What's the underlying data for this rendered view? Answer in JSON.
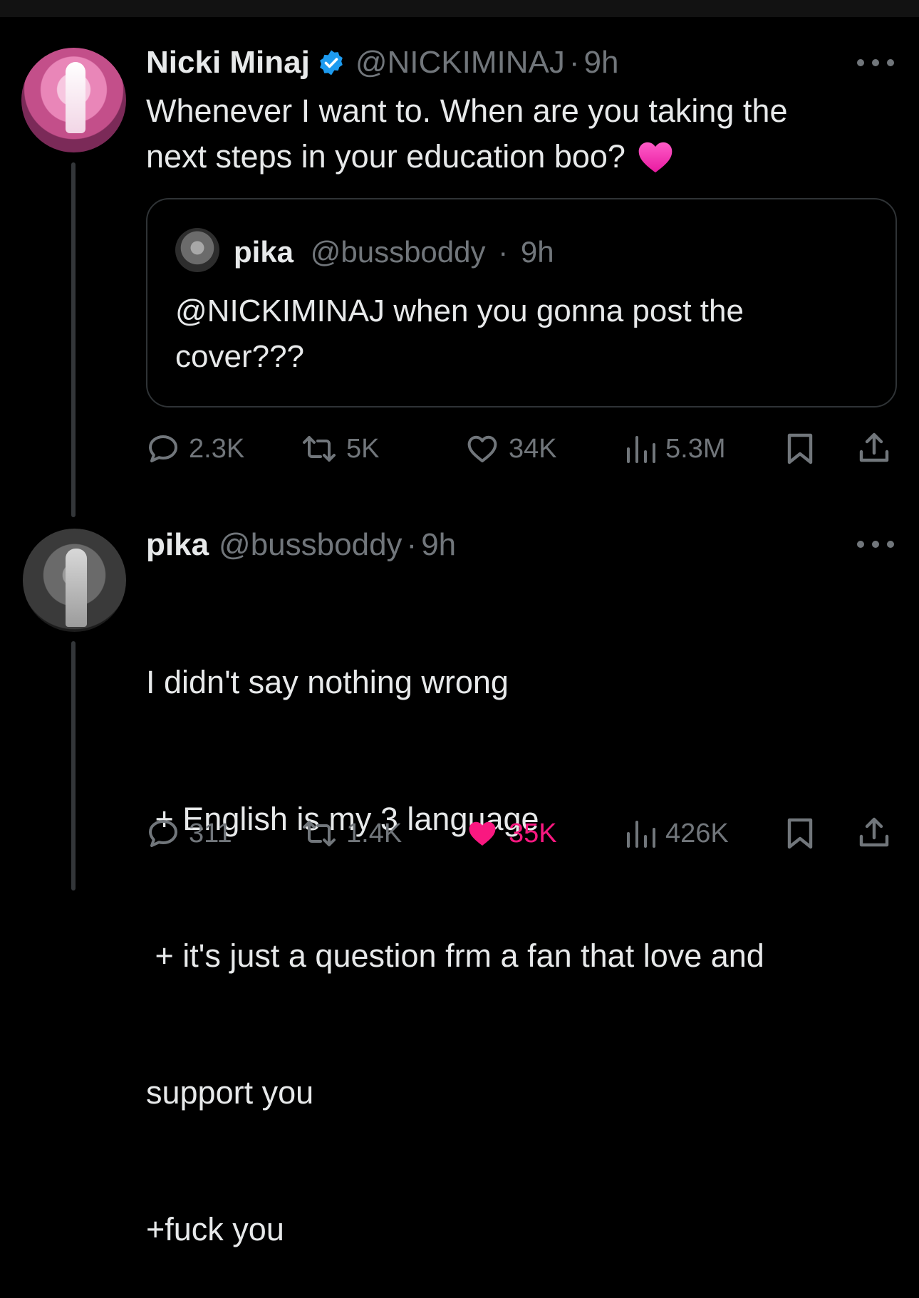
{
  "main_tweet": {
    "name": "Nicki Minaj",
    "handle": "@NICKIMINAJ",
    "separator": "·",
    "time": "9h",
    "text_line1": "Whenever I want to. When are you taking the",
    "text_line2": "next steps in your education boo?",
    "emoji": "💗",
    "quote": {
      "name": "pika",
      "handle": "@bussboddy",
      "separator": "·",
      "time": "9h",
      "text_line1": "@NICKIMINAJ when you gonna post the",
      "text_line2": "cover???"
    },
    "actions": {
      "replies": "2.3K",
      "reposts": "5K",
      "likes": "34K",
      "views": "5.3M"
    }
  },
  "reply_tweet": {
    "name": "pika",
    "handle": "@bussboddy",
    "separator": "·",
    "time": "9h",
    "lines": [
      "I didn't say nothing wrong",
      " + English is my 3 language",
      " + it's just a question frm a fan that love and",
      "support you",
      "+fuck you"
    ],
    "actions": {
      "replies": "311",
      "reposts": "1.4K",
      "likes": "35K",
      "views": "426K"
    },
    "liked": true
  },
  "colors": {
    "background": "#000000",
    "text_primary": "#e7e9ea",
    "text_secondary": "#71767b",
    "verified_blue": "#1d9bf0",
    "like_pink": "#f91880",
    "border": "#2f3336"
  },
  "icons": [
    "more-icon",
    "verified-icon",
    "reply-icon",
    "repost-icon",
    "like-icon",
    "views-icon",
    "bookmark-icon",
    "share-icon"
  ]
}
